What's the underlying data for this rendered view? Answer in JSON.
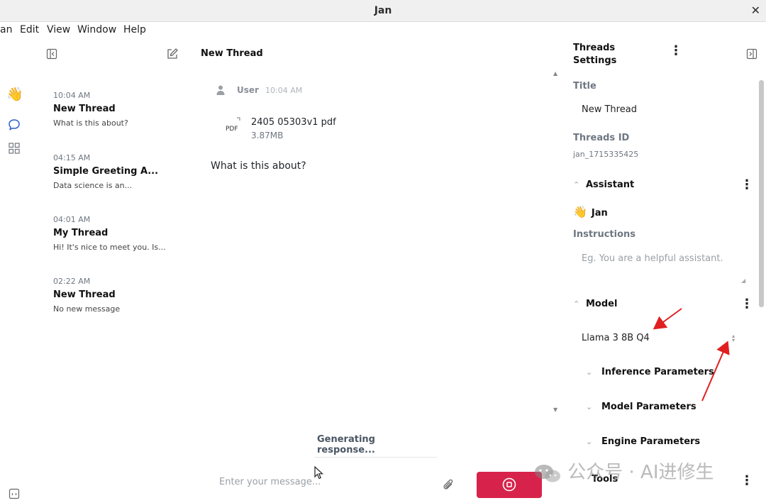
{
  "window": {
    "title": "Jan",
    "close_icon": "close-icon"
  },
  "menu": [
    "an",
    "Edit",
    "View",
    "Window",
    "Help"
  ],
  "rail": {
    "icons": [
      "wave-emoji-icon",
      "chat-icon",
      "grid-icon",
      "bottom-panel-icon"
    ]
  },
  "threads": [
    {
      "time": "10:04 AM",
      "name": "New Thread",
      "preview": "What is this about?"
    },
    {
      "time": "04:15 AM",
      "name": "Simple Greeting A...",
      "preview": "Data science is an..."
    },
    {
      "time": "04:01 AM",
      "name": "My Thread",
      "preview": "Hi! It's nice to meet you. Is..."
    },
    {
      "time": "02:22 AM",
      "name": "New Thread",
      "preview": "No new message"
    }
  ],
  "chat": {
    "header": "New Thread",
    "user_label": "User",
    "user_time": "10:04 AM",
    "file_type": "PDF",
    "file_name": "2405 05303v1 pdf",
    "file_size": "3.87MB",
    "message": "What is this about?",
    "status": "Generating response...",
    "input_placeholder": "Enter your message...",
    "stop_color": "#d7234b"
  },
  "settings": {
    "header": "Threads Settings",
    "title_label": "Title",
    "title_value": "New Thread",
    "id_label": "Threads ID",
    "id_value": "jan_1715335425",
    "assistant_section": "Assistant",
    "assistant_name": "Jan",
    "instructions_label": "Instructions",
    "instructions_placeholder": "Eg. You are a helpful assistant.",
    "model_section": "Model",
    "model_value": "Llama 3 8B Q4",
    "inference_params": "Inference Parameters",
    "model_params": "Model Parameters",
    "engine_params": "Engine Parameters",
    "tools_section": "Tools"
  },
  "annotation_color": "#e02020",
  "watermark": "公众号 · AI进修生"
}
